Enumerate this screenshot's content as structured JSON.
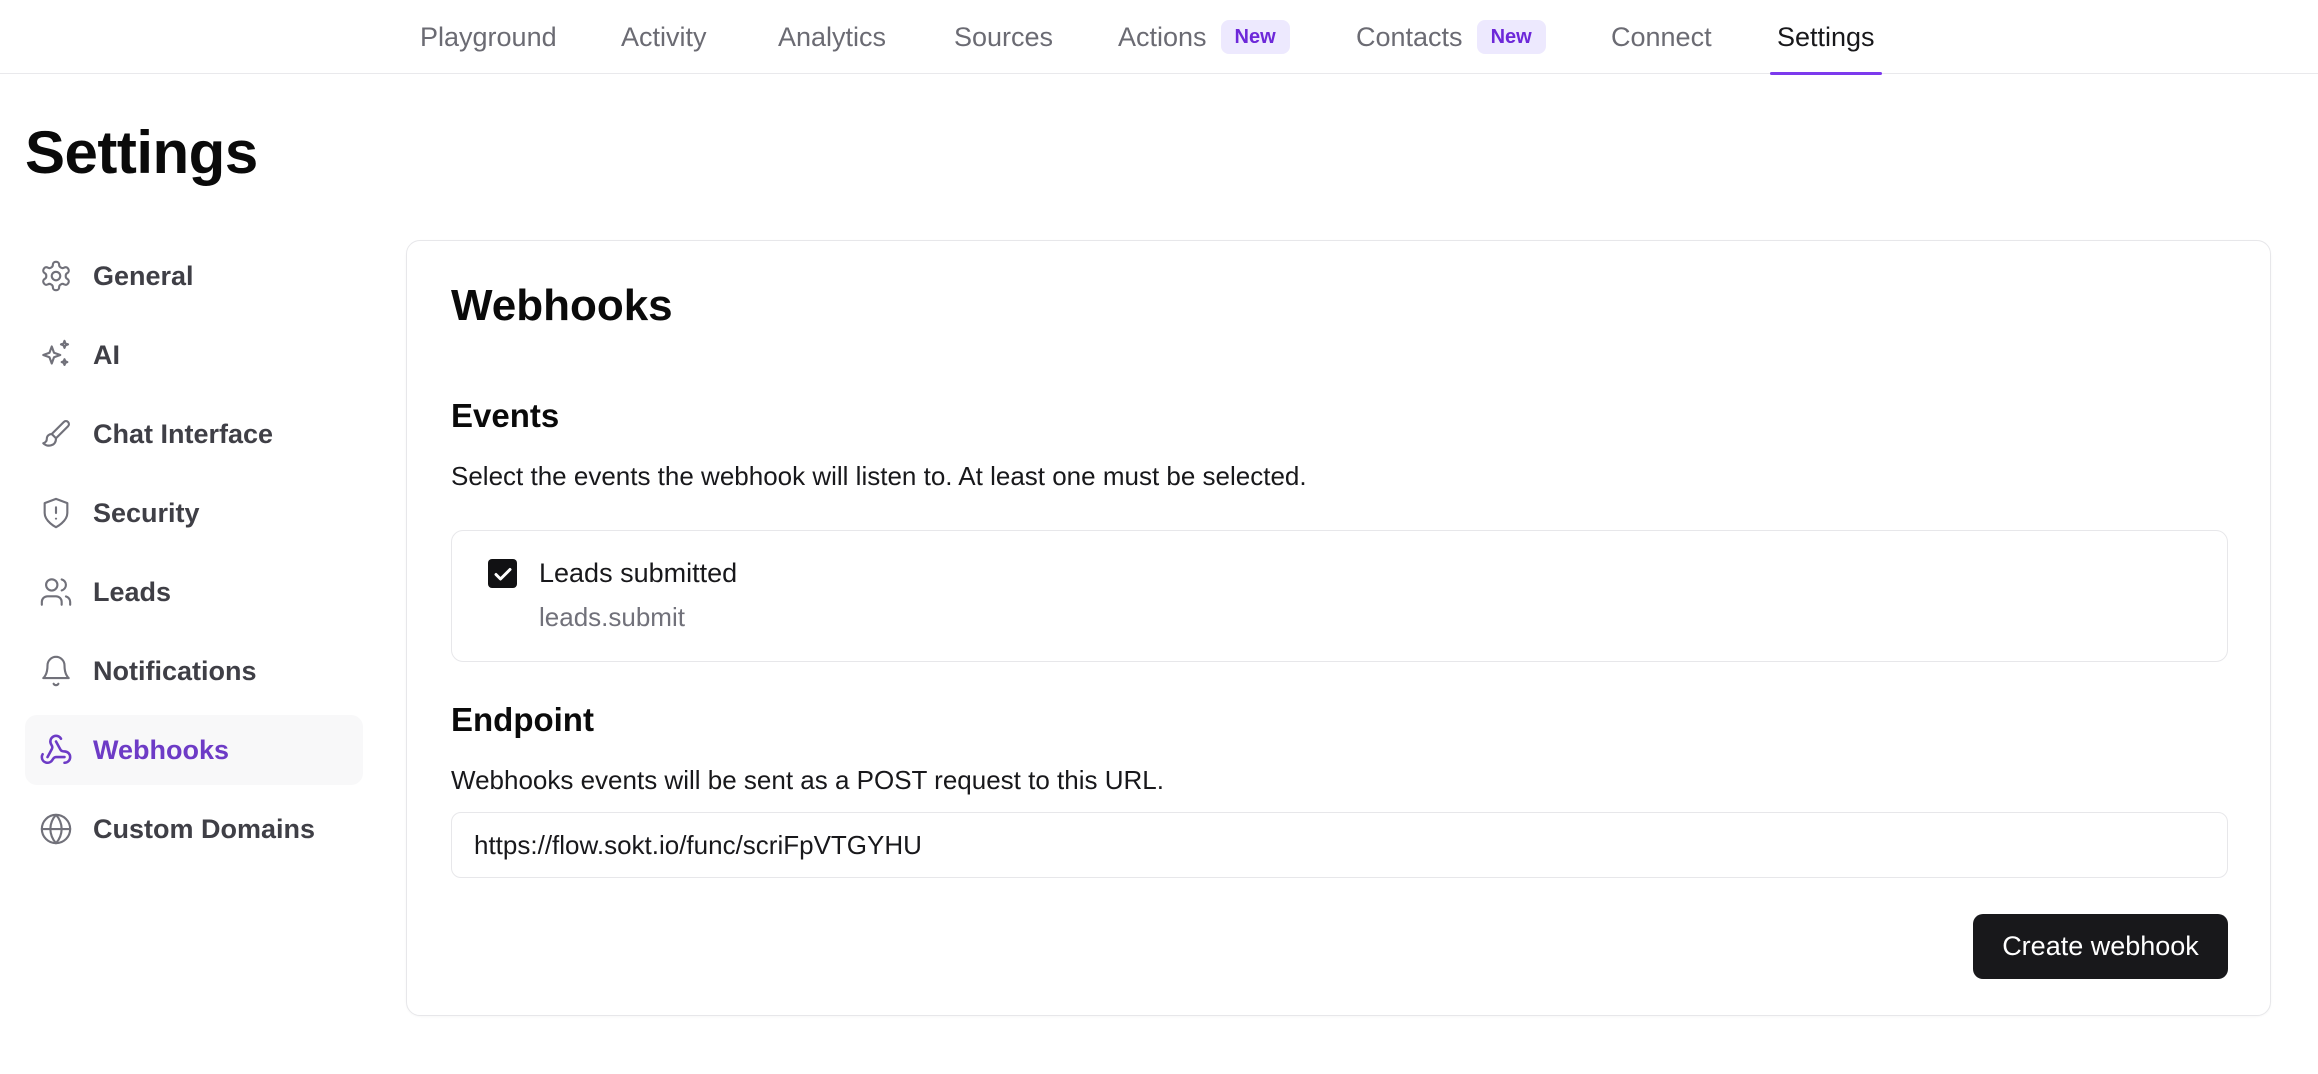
{
  "topnav": {
    "tabs": [
      {
        "label": "Playground"
      },
      {
        "label": "Activity"
      },
      {
        "label": "Analytics"
      },
      {
        "label": "Sources"
      },
      {
        "label": "Actions",
        "badge": "New"
      },
      {
        "label": "Contacts",
        "badge": "New"
      },
      {
        "label": "Connect"
      },
      {
        "label": "Settings",
        "active": true
      }
    ]
  },
  "page": {
    "title": "Settings"
  },
  "sidebar": {
    "items": [
      {
        "label": "General",
        "icon": "gear-icon"
      },
      {
        "label": "AI",
        "icon": "sparkles-icon"
      },
      {
        "label": "Chat Interface",
        "icon": "brush-icon"
      },
      {
        "label": "Security",
        "icon": "shield-icon"
      },
      {
        "label": "Leads",
        "icon": "users-icon"
      },
      {
        "label": "Notifications",
        "icon": "bell-icon"
      },
      {
        "label": "Webhooks",
        "icon": "webhook-icon",
        "active": true
      },
      {
        "label": "Custom Domains",
        "icon": "globe-icon"
      }
    ]
  },
  "webhooks": {
    "title": "Webhooks",
    "events": {
      "heading": "Events",
      "description": "Select the events the webhook will listen to. At least one must be selected.",
      "items": [
        {
          "label": "Leads submitted",
          "code": "leads.submit",
          "checked": true
        }
      ]
    },
    "endpoint": {
      "heading": "Endpoint",
      "description": "Webhooks events will be sent as a POST request to this URL.",
      "value": "https://flow.sokt.io/func/scriFpVTGYHU"
    },
    "create_button": "Create webhook"
  },
  "colors": {
    "accent": "#7c3aed",
    "accent_text": "#6d3bc6",
    "badge_bg": "#ede9fe",
    "button_bg": "#18181b"
  }
}
